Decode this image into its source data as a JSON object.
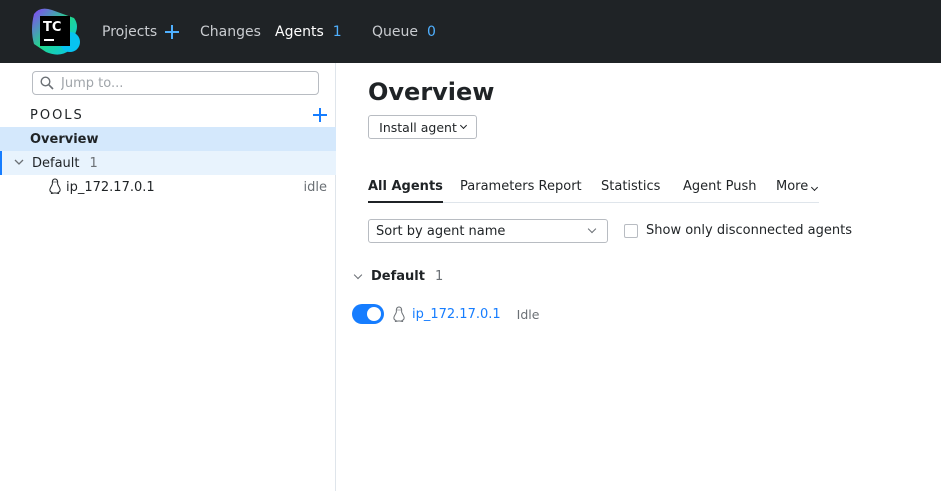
{
  "header": {
    "logo_text": "TC",
    "nav": {
      "projects": "Projects",
      "changes": "Changes",
      "agents": "Agents",
      "agents_count": "1",
      "queue": "Queue",
      "queue_count": "0"
    }
  },
  "sidebar": {
    "search_placeholder": "Jump to...",
    "pools_label": "POOLS",
    "overview": "Overview",
    "default_pool": {
      "label": "Default",
      "count": "1"
    },
    "agent": {
      "name": "ip_172.17.0.1",
      "status": "idle"
    }
  },
  "main": {
    "title": "Overview",
    "install_agent": "Install agent",
    "tabs": [
      "All Agents",
      "Parameters Report",
      "Statistics",
      "Agent Push",
      "More"
    ],
    "sort_value": "Sort by agent name",
    "checkbox_label": "Show only disconnected agents",
    "group": {
      "label": "Default",
      "count": "1"
    },
    "agent": {
      "name": "ip_172.17.0.1",
      "status": "Idle",
      "enabled": true
    }
  },
  "colors": {
    "header_bg": "#1f2326",
    "accent": "#167dff",
    "selected_bg": "#d4e8fc"
  }
}
